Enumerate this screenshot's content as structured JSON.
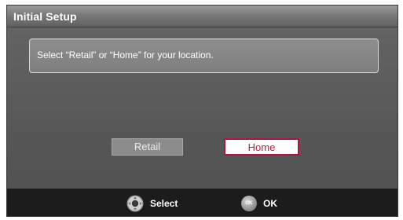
{
  "dialog": {
    "title": "Initial Setup",
    "message": "Select “Retail” or “Home” for your location."
  },
  "options": {
    "retail_label": "Retail",
    "home_label": "Home",
    "selected": "Home"
  },
  "footer": {
    "select_icon": "dpad-icon",
    "select_label": "Select",
    "ok_icon": "ok-button-icon",
    "ok_icon_text": "OK",
    "ok_label": "OK"
  },
  "colors": {
    "highlight_border": "#b3133d",
    "highlight_text": "#c41a3a"
  }
}
